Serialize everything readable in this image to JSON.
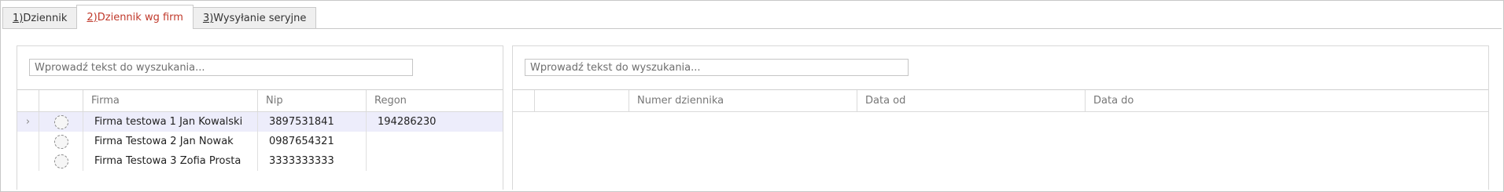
{
  "tabs": [
    {
      "key": "1)",
      "label": " Dziennik",
      "active": false
    },
    {
      "key": "2)",
      "label": " Dziennik wg firm",
      "active": true
    },
    {
      "key": "3)",
      "label": " Wysyłanie seryjne",
      "active": false
    }
  ],
  "left_panel": {
    "search_placeholder": "Wprowadź tekst do wyszukania...",
    "columns": [
      "",
      "",
      "Firma",
      "Nip",
      "Regon"
    ],
    "rows": [
      {
        "indicator": "›",
        "icon": "company-status-icon",
        "firma": "Firma testowa 1 Jan Kowalski",
        "nip": "3897531841",
        "regon": "194286230",
        "selected": true
      },
      {
        "indicator": "",
        "icon": "company-status-icon",
        "firma": "Firma Testowa 2 Jan Nowak",
        "nip": "0987654321",
        "regon": "",
        "selected": false
      },
      {
        "indicator": "",
        "icon": "company-status-icon",
        "firma": "Firma Testowa 3 Zofia Prosta",
        "nip": "3333333333",
        "regon": "",
        "selected": false
      }
    ]
  },
  "right_panel": {
    "search_placeholder": "Wprowadź tekst do wyszukania...",
    "columns": [
      "",
      "",
      "Numer dziennika",
      "Data od",
      "Data do"
    ],
    "rows": []
  },
  "colors": {
    "active_tab_text": "#c0392b",
    "selected_row_bg": "#ededfb"
  }
}
